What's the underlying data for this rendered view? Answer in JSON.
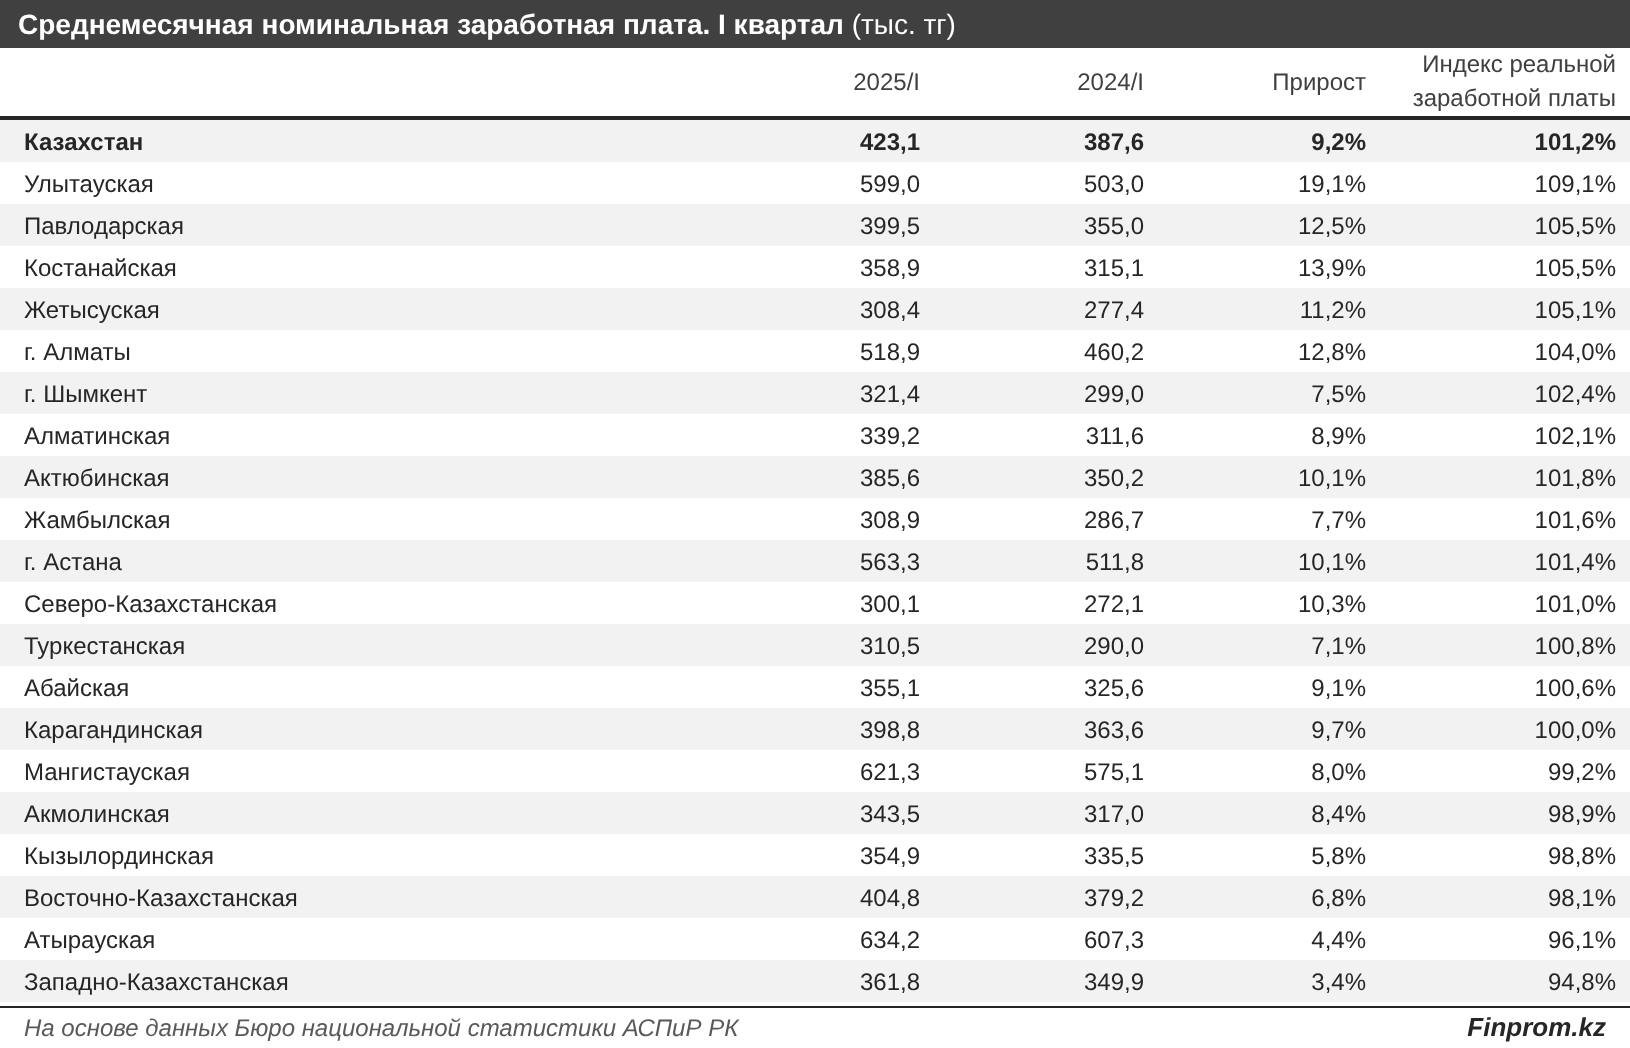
{
  "title": "**Среднемесячная номинальная заработная плата. I квартал** (тыс. тг)",
  "table": {
    "columns": [
      {},
      {
        "label": "2025/I"
      },
      {
        "label": "2024/I"
      },
      {
        "label": "Прирост"
      },
      {
        "label": "Индекс реальной заработной платы"
      }
    ],
    "rows": [
      {
        "kind": "total",
        "cells": [
          "Казахстан",
          "423,1",
          "387,6",
          "9,2%",
          "101,2%"
        ]
      },
      {
        "kind": "region",
        "cells": [
          "Улытауская",
          "599,0",
          "503,0",
          "19,1%",
          "109,1%"
        ]
      },
      {
        "kind": "region",
        "cells": [
          "Павлодарская",
          "399,5",
          "355,0",
          "12,5%",
          "105,5%"
        ]
      },
      {
        "kind": "region",
        "cells": [
          "Костанайская",
          "358,9",
          "315,1",
          "13,9%",
          "105,5%"
        ]
      },
      {
        "kind": "region",
        "cells": [
          "Жетысуская",
          "308,4",
          "277,4",
          "11,2%",
          "105,1%"
        ]
      },
      {
        "kind": "region",
        "cells": [
          "г. Алматы",
          "518,9",
          "460,2",
          "12,8%",
          "104,0%"
        ]
      },
      {
        "kind": "region",
        "cells": [
          "г. Шымкент",
          "321,4",
          "299,0",
          "7,5%",
          "102,4%"
        ]
      },
      {
        "kind": "region",
        "cells": [
          "Алматинская",
          "339,2",
          "311,6",
          "8,9%",
          "102,1%"
        ]
      },
      {
        "kind": "region",
        "cells": [
          "Актюбинская",
          "385,6",
          "350,2",
          "10,1%",
          "101,8%"
        ]
      },
      {
        "kind": "region",
        "cells": [
          "Жамбылская",
          "308,9",
          "286,7",
          "7,7%",
          "101,6%"
        ]
      },
      {
        "kind": "region",
        "cells": [
          "г. Астана",
          "563,3",
          "511,8",
          "10,1%",
          "101,4%"
        ]
      },
      {
        "kind": "region",
        "cells": [
          "Северо-Казахстанская",
          "300,1",
          "272,1",
          "10,3%",
          "101,0%"
        ]
      },
      {
        "kind": "region",
        "cells": [
          "Туркестанская",
          "310,5",
          "290,0",
          "7,1%",
          "100,8%"
        ]
      },
      {
        "kind": "region",
        "cells": [
          "Абайская",
          "355,1",
          "325,6",
          "9,1%",
          "100,6%"
        ]
      },
      {
        "kind": "region",
        "cells": [
          "Карагандинская",
          "398,8",
          "363,6",
          "9,7%",
          "100,0%"
        ]
      },
      {
        "kind": "region",
        "cells": [
          "Мангистауская",
          "621,3",
          "575,1",
          "8,0%",
          "99,2%"
        ]
      },
      {
        "kind": "region",
        "cells": [
          "Акмолинская",
          "343,5",
          "317,0",
          "8,4%",
          "98,9%"
        ]
      },
      {
        "kind": "region",
        "cells": [
          "Кызылординская",
          "354,9",
          "335,5",
          "5,8%",
          "98,8%"
        ]
      },
      {
        "kind": "region",
        "cells": [
          "Восточно-Казахстанская",
          "404,8",
          "379,2",
          "6,8%",
          "98,1%"
        ]
      },
      {
        "kind": "region",
        "cells": [
          "Атырауская",
          "634,2",
          "607,3",
          "4,4%",
          "96,1%"
        ]
      },
      {
        "kind": "region",
        "cells": [
          "Западно-Казахстанская",
          "361,8",
          "349,9",
          "3,4%",
          "94,8%"
        ]
      }
    ]
  },
  "footer": {
    "source": "На основе данных Бюро национальной статистики АСПиР РК",
    "brand": "Finprom.kz"
  }
}
